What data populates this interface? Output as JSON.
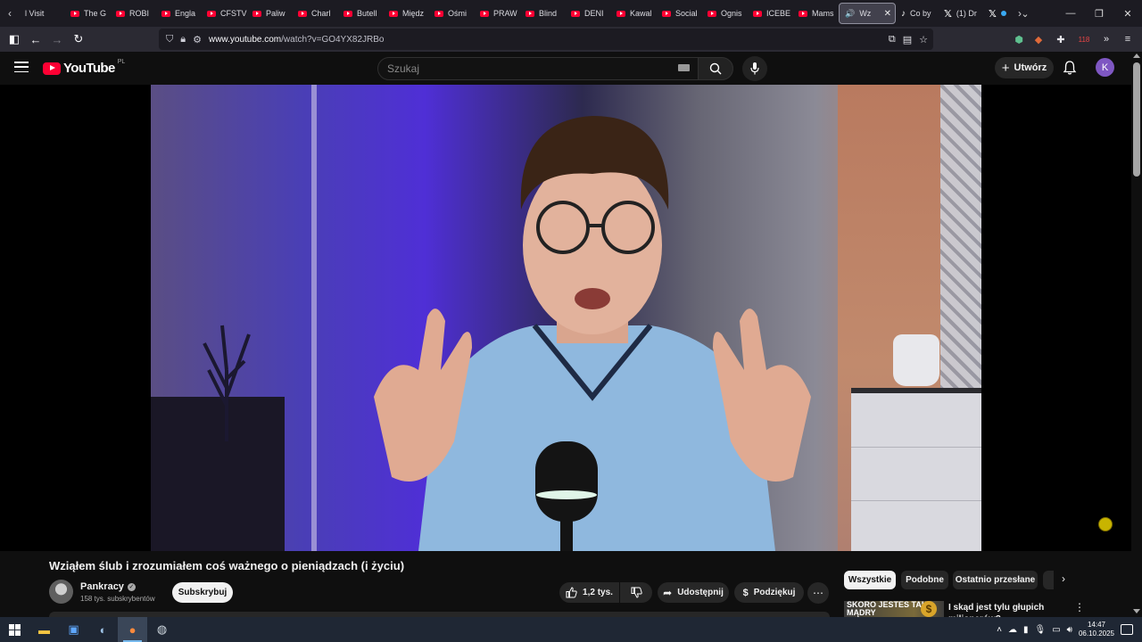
{
  "browser": {
    "tabs": [
      {
        "label": "l Visit",
        "fav": false
      },
      {
        "label": "The G",
        "fav": true
      },
      {
        "label": "ROBI",
        "fav": true
      },
      {
        "label": "Engla",
        "fav": true
      },
      {
        "label": "CFSTV",
        "fav": true
      },
      {
        "label": "Paliw",
        "fav": true
      },
      {
        "label": "Charl",
        "fav": true
      },
      {
        "label": "Butell",
        "fav": true
      },
      {
        "label": "Międz",
        "fav": true
      },
      {
        "label": "Ośmi",
        "fav": true
      },
      {
        "label": "PRAW",
        "fav": true
      },
      {
        "label": "Blind",
        "fav": true
      },
      {
        "label": "DENI",
        "fav": true
      },
      {
        "label": "Kawal",
        "fav": true
      },
      {
        "label": "Social",
        "fav": true
      },
      {
        "label": "Ognis",
        "fav": true
      },
      {
        "label": "ICEBE",
        "fav": true
      },
      {
        "label": "Mams",
        "fav": true
      }
    ],
    "active_tab": {
      "label": "Wz",
      "speaker_icon": "speaker-icon",
      "close_icon": "close-icon"
    },
    "extra_tabs": [
      {
        "label": "Co by",
        "icon": "tiktok-icon"
      },
      {
        "label": "(1) Dr",
        "icon": "x-logo-icon"
      },
      {
        "label": "",
        "icon": "x-logo-icon"
      }
    ],
    "url_host": "www.youtube.com",
    "url_path": "/watch?v=GO4YX82JRBo",
    "extensions_badge": "118"
  },
  "youtube": {
    "logo_text": "YouTube",
    "region": "PL",
    "search_placeholder": "Szukaj",
    "create_label": "Utwórz",
    "avatar_letter": "K",
    "video": {
      "title": "Wziąłem ślub i zrozumiałem coś ważnego o pieniądzach (i życiu)",
      "channel": "Pankracy",
      "subscribers": "158 tys. subskrybentów",
      "subscribe_label": "Subskrybuj",
      "likes": "1,2 tys.",
      "share_label": "Udostępnij",
      "thanks_label": "Podziękuj"
    },
    "chips": [
      "Wszystkie",
      "Podobne",
      "Ostatnio przesłane"
    ],
    "recommended": {
      "thumb_text": "SKORO JESTEŚ TAKI MĄDRY",
      "title": "I skąd jest tylu głupich milionerów?"
    }
  },
  "taskbar": {
    "time": "14:47",
    "date": "06.10.2025"
  }
}
